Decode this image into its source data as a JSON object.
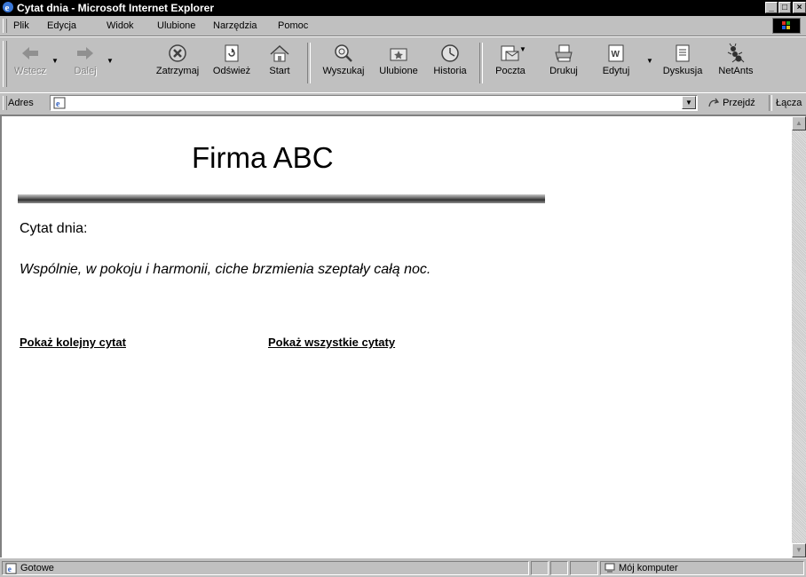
{
  "window": {
    "title": "Cytat dnia - Microsoft Internet Explorer",
    "minimize": "_",
    "maximize": "□",
    "close": "×"
  },
  "menu": [
    "Plik",
    "Edycja",
    "Widok",
    "Ulubione",
    "Narzędzia",
    "Pomoc"
  ],
  "toolbar": {
    "back": "Wstecz",
    "forward": "Dalej",
    "stop": "Zatrzymaj",
    "refresh": "Odśwież",
    "home": "Start",
    "search": "Wyszukaj",
    "favorites": "Ulubione",
    "history": "Historia",
    "mail": "Poczta",
    "print": "Drukuj",
    "edit": "Edytuj",
    "discuss": "Dyskusja",
    "netants": "NetAnts"
  },
  "address": {
    "label": "Adres",
    "value": "",
    "go": "Przejdź",
    "links": "Łącza"
  },
  "page": {
    "heading": "Firma ABC",
    "quote_label": "Cytat dnia:",
    "quote": "Wspólnie, w pokoju i harmonii, ciche brzmienia szeptały całą noc.",
    "link_next": "Pokaż kolejny cytat",
    "link_all": "Pokaż wszystkie cytaty"
  },
  "status": {
    "text": "Gotowe",
    "zone": "Mój komputer"
  }
}
